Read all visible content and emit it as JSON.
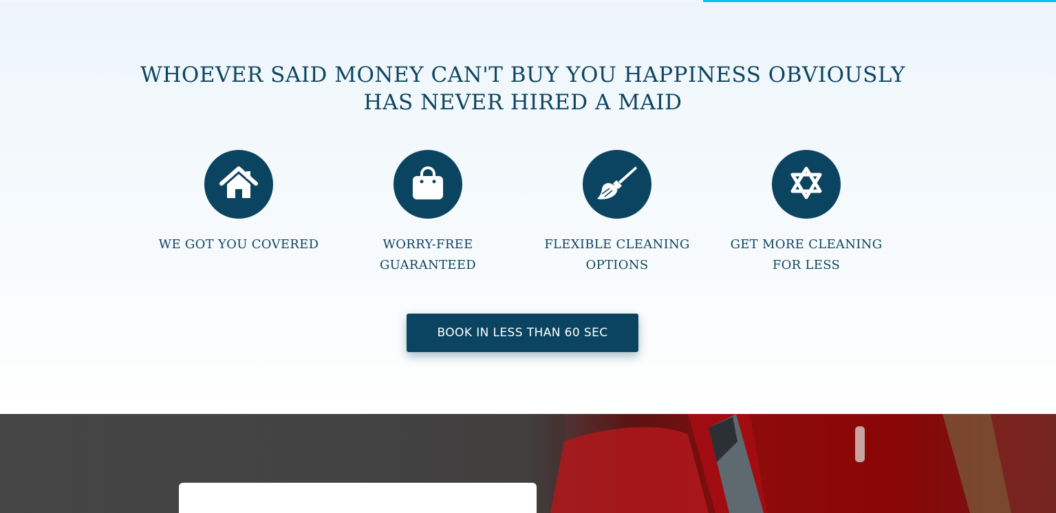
{
  "progress": {
    "value_percent": 33.4,
    "color": "#00c3f0"
  },
  "headline": "WHOEVER SAID MONEY CAN'T BUY YOU HAPPINESS OBVIOUSLY HAS NEVER HIRED A MAID",
  "features": [
    {
      "icon": "house-icon",
      "label": "WE GOT YOU COVERED"
    },
    {
      "icon": "shopping-bag-icon",
      "label": "WORRY-FREE GUARANTEED"
    },
    {
      "icon": "paint-brush-icon",
      "label": "FLEXIBLE CLEANING OPTIONS"
    },
    {
      "icon": "star-of-david-icon",
      "label": "GET MORE CLEANING FOR LESS"
    }
  ],
  "cta": {
    "label": "BOOK IN LESS THAN 60 SEC"
  },
  "colors": {
    "primary": "#0b4460",
    "text": "#0d4560",
    "accent": "#00c3f0"
  }
}
